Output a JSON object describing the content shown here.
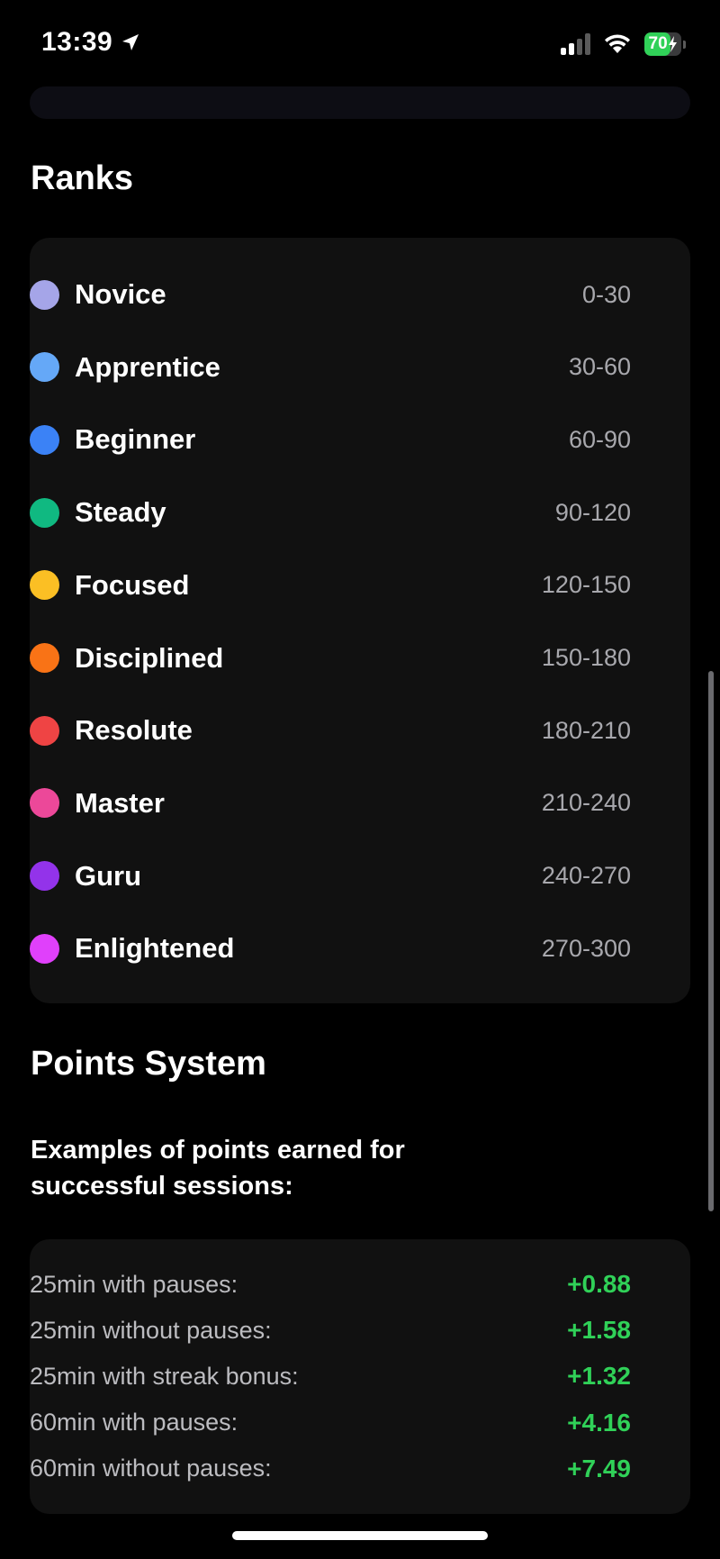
{
  "status_bar": {
    "time": "13:39",
    "battery_level": 70,
    "battery_label": "70",
    "location_icon": "location-arrow-icon",
    "signal_icon": "cellular-signal-icon",
    "wifi_icon": "wifi-icon",
    "charging_icon": "charging-bolt-icon"
  },
  "ranks": {
    "title": "Ranks",
    "items": [
      {
        "name": "Novice",
        "range": "0-30",
        "color": "#a5a5e8"
      },
      {
        "name": "Apprentice",
        "range": "30-60",
        "color": "#65a8f7"
      },
      {
        "name": "Beginner",
        "range": "60-90",
        "color": "#3b82f6"
      },
      {
        "name": "Steady",
        "range": "90-120",
        "color": "#10b981"
      },
      {
        "name": "Focused",
        "range": "120-150",
        "color": "#fbbf24"
      },
      {
        "name": "Disciplined",
        "range": "150-180",
        "color": "#f97316"
      },
      {
        "name": "Resolute",
        "range": "180-210",
        "color": "#ef4444"
      },
      {
        "name": "Master",
        "range": "210-240",
        "color": "#ec4899"
      },
      {
        "name": "Guru",
        "range": "240-270",
        "color": "#9333ea"
      },
      {
        "name": "Enlightened",
        "range": "270-300",
        "color": "#e040fb"
      }
    ]
  },
  "points_system": {
    "title": "Points System",
    "intro": "Examples of points earned for successful sessions:",
    "value_color": "#30d158",
    "examples": [
      {
        "label": "25min with pauses:",
        "value": "+0.88"
      },
      {
        "label": "25min without pauses:",
        "value": "+1.58"
      },
      {
        "label": "25min with streak bonus:",
        "value": "+1.32"
      },
      {
        "label": "60min with pauses:",
        "value": "+4.16"
      },
      {
        "label": "60min without pauses:",
        "value": "+7.49"
      }
    ]
  }
}
